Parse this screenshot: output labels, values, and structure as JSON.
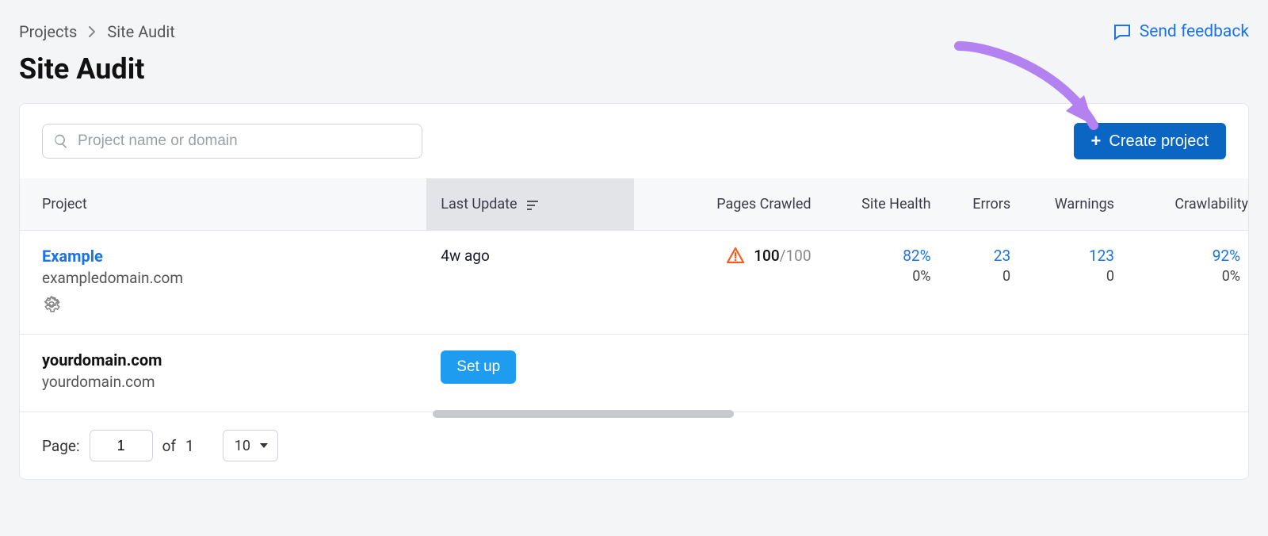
{
  "breadcrumb": {
    "root": "Projects",
    "current": "Site Audit"
  },
  "feedback": {
    "label": "Send feedback"
  },
  "page_title": "Site Audit",
  "search": {
    "placeholder": "Project name or domain",
    "value": ""
  },
  "create_button": {
    "label": "Create project"
  },
  "table": {
    "columns": {
      "project": "Project",
      "last_update": "Last Update",
      "pages_crawled": "Pages Crawled",
      "site_health": "Site Health",
      "errors": "Errors",
      "warnings": "Warnings",
      "crawlability": "Crawlability"
    },
    "sorted_column": "last_update",
    "rows": [
      {
        "name": "Example",
        "domain": "exampledomain.com",
        "name_is_link": true,
        "has_settings": true,
        "last_update": "4w ago",
        "pages_crawled": {
          "value": "100",
          "total": "/100",
          "warning": true
        },
        "site_health": {
          "value": "82%",
          "delta": "0%"
        },
        "errors": {
          "value": "23",
          "delta": "0"
        },
        "warnings": {
          "value": "123",
          "delta": "0"
        },
        "crawlability": {
          "value": "92%",
          "delta": "0%"
        }
      },
      {
        "name": "yourdomain.com",
        "domain": "yourdomain.com",
        "name_is_link": false,
        "has_settings": false,
        "setup_label": "Set up"
      }
    ]
  },
  "pagination": {
    "label": "Page:",
    "current": "1",
    "of_label": "of",
    "total": "1",
    "per_page": "10"
  }
}
